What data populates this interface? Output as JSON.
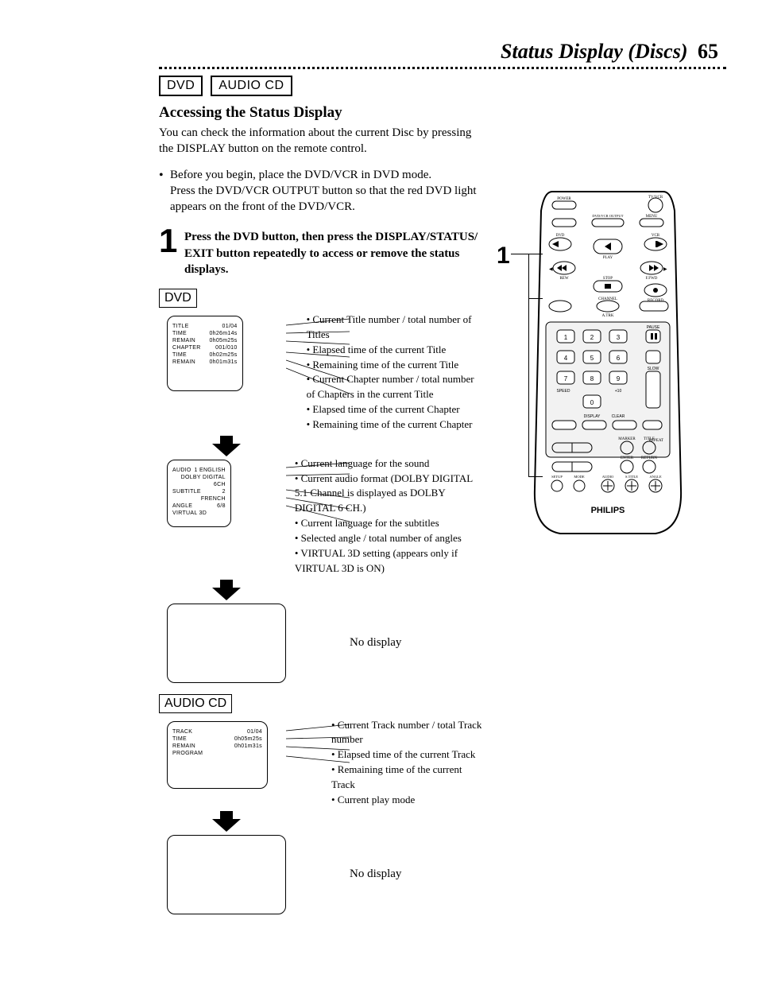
{
  "header": {
    "title": "Status Display (Discs)",
    "page_number": "65"
  },
  "tags": {
    "dvd": "DVD",
    "audio_cd": "AUDIO CD"
  },
  "section_title": "Accessing the Status Display",
  "intro": "You can check the information about the current Disc by pressing the DISPLAY button on the remote control.",
  "prep": {
    "line1": "Before you begin, place the DVD/VCR in DVD mode.",
    "line2": "Press the DVD/VCR OUTPUT button so that the red DVD light appears on the front of the DVD/VCR."
  },
  "step1": {
    "num": "1",
    "text": "Press the DVD button, then press the DISPLAY/STATUS/ EXIT button repeatedly to access or remove the status displays."
  },
  "dvd_label": "DVD",
  "dvd_box1": {
    "rows": [
      {
        "l": "TITLE",
        "r": "01/04"
      },
      {
        "l": "TIME",
        "r": "0h26m14s"
      },
      {
        "l": "REMAIN",
        "r": "0h05m25s"
      },
      {
        "l": "CHAPTER",
        "r": "001/010"
      },
      {
        "l": "TIME",
        "r": "0h02m25s"
      },
      {
        "l": "REMAIN",
        "r": "0h01m31s"
      }
    ]
  },
  "dvd_box1_callouts": [
    "Current Title number / total number of Titles",
    "Elapsed time of the current Title",
    "Remaining time of the current Title",
    "Current Chapter number / total number of Chapters in the current Title",
    "Elapsed time of the current Chapter",
    "Remaining time of the current Chapter"
  ],
  "dvd_box2": {
    "rows": [
      {
        "l": "AUDIO",
        "r": "1 ENGLISH"
      },
      {
        "l": "",
        "r": "DOLBY DIGITAL"
      },
      {
        "l": "",
        "r": "6CH"
      },
      {
        "l": "SUBTITLE",
        "r": "2 FRENCH"
      },
      {
        "l": "ANGLE",
        "r": "6/8"
      },
      {
        "l": "VIRTUAL 3D",
        "r": ""
      }
    ]
  },
  "dvd_box2_callouts": [
    "Current language for the sound",
    "Current audio format (DOLBY DIGITAL 5.1 Channel is displayed as DOLBY DIGITAL 6 CH.)",
    "Current language for the subtitles",
    "Selected angle / total number of angles",
    "VIRTUAL 3D setting (appears only if VIRTUAL 3D is ON)"
  ],
  "no_display": "No display",
  "audio_cd_label": "AUDIO CD",
  "cd_box1": {
    "rows": [
      {
        "l": "TRACK",
        "r": "01/04"
      },
      {
        "l": "TIME",
        "r": "0h05m25s"
      },
      {
        "l": "REMAIN",
        "r": "0h01m31s"
      },
      {
        "l": "PROGRAM",
        "r": ""
      }
    ]
  },
  "cd_box1_callouts": [
    "Current Track number / total Track number",
    "Elapsed time of the current Track",
    "Remaining time of the current Track",
    "Current play mode"
  ],
  "remote": {
    "brand": "PHILIPS",
    "labels": {
      "power": "POWER",
      "tvvcr": "TV/VCR",
      "dvdvcr_out": "DVD/VCR OUTPUT",
      "menu": "MENU",
      "dvd": "DVD",
      "vcr": "VCR",
      "play": "PLAY",
      "rew": "REW",
      "ffwd": "F.FWD",
      "stop": "STOP",
      "record": "RECORD",
      "channel": "CHANNEL",
      "atrk": "A.TRK",
      "pause": "PAUSE",
      "slow": "SLOW",
      "speed": "SPEED",
      "plus10": "+10",
      "display": "DISPLAY",
      "clear": "CLEAR",
      "repeat": "REPEAT",
      "marker": "MARKER",
      "title": "TITLE",
      "enter": "ENTER",
      "return": "RETURN",
      "setup": "SETUP",
      "mode": "MODE",
      "audio": "AUDIO",
      "subtitle": "S.TITLE",
      "angle": "ANGLE",
      "k1": "1",
      "k2": "2",
      "k3": "3",
      "k4": "4",
      "k5": "5",
      "k6": "6",
      "k7": "7",
      "k8": "8",
      "k9": "9",
      "k0": "0"
    }
  }
}
